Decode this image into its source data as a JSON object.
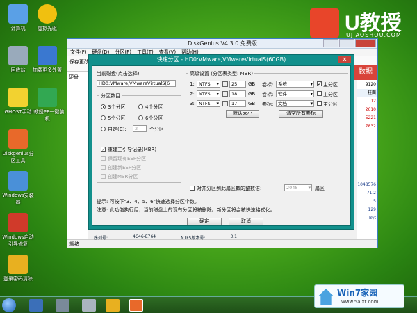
{
  "desktop_icons": [
    {
      "label": "计算机",
      "color": "#5aa0e6"
    },
    {
      "label": "虚拟光驱",
      "color": "#f0c010"
    },
    {
      "label": "回收站",
      "color": "#9ab"
    },
    {
      "label": "加载更多外置",
      "color": "#3a78d0"
    },
    {
      "label": "GHOST手动",
      "color": "#f2d230"
    },
    {
      "label": "U教授PE一键装机",
      "color": "#32a852"
    },
    {
      "label": "Diskgenius分区工具",
      "color": "#e8692a"
    },
    {
      "label": "Windows安装器",
      "color": "#4a90d8"
    },
    {
      "label": "Windows启动引导修复",
      "color": "#d03a2a"
    },
    {
      "label": "登录密码清除",
      "color": "#e8b020"
    }
  ],
  "logo": {
    "title": "U教授",
    "url": "UJIAOSHOU.COM"
  },
  "diskgenius": {
    "title": "DiskGenius V4.3.0 免费版",
    "menu": [
      "文件(F)",
      "硬盘(D)",
      "分区(P)",
      "工具(T)",
      "查看(V)",
      "帮助(H)"
    ],
    "toolbar_save": "保存更改",
    "disk_label": "硬盘",
    "status": "就绪",
    "right_values": [
      "数据",
      "9120",
      "柱面",
      "12",
      "2610",
      "5221",
      "7832"
    ],
    "right_values2": [
      "1048576",
      "71.2",
      "5",
      "129",
      "Byt"
    ],
    "serial_label": "序列号:",
    "serial_value": "4C46-E764",
    "ntfs_label": "NTFS版本号:",
    "ntfs_value": "3.1",
    "side_text": "数据"
  },
  "dialog": {
    "title": "快速分区 - HD0:VMware,VMwareVirtualS(60GB)",
    "current_disk_label": "当前磁盘(点击选择)",
    "current_disk_value": "HD0:VMware,VMwareVirtualS(6",
    "partition_count_label": "分区数目",
    "options": [
      "3个分区",
      "4个分区",
      "5个分区",
      "6个分区",
      "自定(C):"
    ],
    "custom_value": "2",
    "custom_unit": "个分区",
    "rebuild_mbr": "重建主引导记录(MBR)",
    "keep_esp": "保留现有ESP分区",
    "create_esp": "创建新ESP分区",
    "create_msr": "创建MSR分区",
    "advanced_label": "高级设置 (分区表类型: MBR)",
    "rows": [
      {
        "n": "1:",
        "fs": "NTFS",
        "size": "25",
        "unit": "GB",
        "vol_label": "卷标:",
        "vol": "系统",
        "primary": "主分区",
        "checked": true
      },
      {
        "n": "2:",
        "fs": "NTFS",
        "size": "18",
        "unit": "GB",
        "vol_label": "卷标:",
        "vol": "软件",
        "primary": "主分区",
        "checked": false
      },
      {
        "n": "3:",
        "fs": "NTFS",
        "size": "17",
        "unit": "GB",
        "vol_label": "卷标:",
        "vol": "文档",
        "primary": "主分区",
        "checked": false
      }
    ],
    "default_size": "默认大小",
    "clear_labels": "清空所有卷标",
    "align_label": "对齐分区到此扇区数的整数倍:",
    "align_value": "2048",
    "align_unit": "扇区",
    "hint": "提示: 可按下\"3、4、5、6\"快速选择分区个数。",
    "note": "注意: 此功能执行后，当前磁盘上的现有分区将被删除。新分区将会被快速格式化。",
    "ok": "确定",
    "cancel": "取消"
  },
  "watermark": {
    "name": "Win7家园",
    "url": "www.5aixt.com"
  }
}
